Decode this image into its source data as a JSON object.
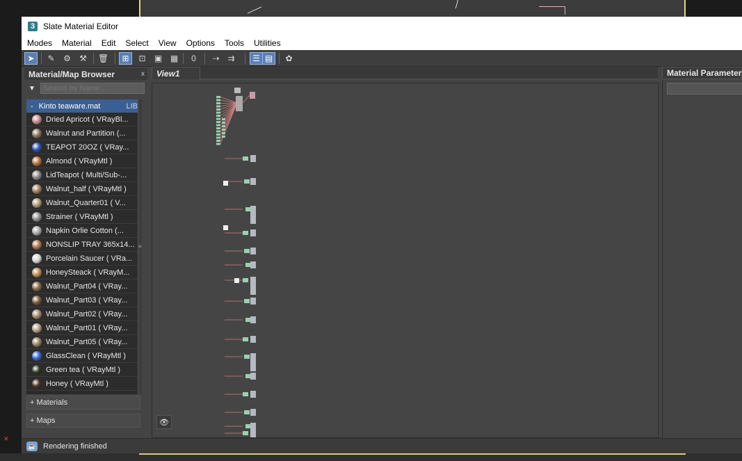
{
  "window": {
    "title": "Slate Material Editor",
    "app_icon": "3"
  },
  "menu": [
    "Modes",
    "Material",
    "Edit",
    "Select",
    "View",
    "Options",
    "Tools",
    "Utilities"
  ],
  "toolbar": {
    "icons": [
      {
        "name": "select-tool-icon",
        "glyph": "➤",
        "active": true
      },
      {
        "name": "pick-material-icon",
        "glyph": "✎",
        "active": false
      },
      {
        "name": "put-to-scene-icon",
        "glyph": "⚙",
        "active": false
      },
      {
        "name": "assign-material-icon",
        "glyph": "⚒",
        "active": false
      },
      {
        "name": "delete-icon",
        "glyph": "🗑",
        "active": false
      },
      {
        "name": "move-children-icon",
        "glyph": "⊞",
        "active": true
      },
      {
        "name": "lock-icon",
        "glyph": "⊡",
        "active": false
      },
      {
        "name": "show-map-icon",
        "glyph": "▣",
        "active": false
      },
      {
        "name": "show-background-icon",
        "glyph": "▦",
        "active": false
      },
      {
        "name": "material-id-icon",
        "glyph": "0",
        "active": false
      },
      {
        "name": "layout-all-icon",
        "glyph": "⇢",
        "active": false
      },
      {
        "name": "layout-children-icon",
        "glyph": "⇉",
        "active": false
      },
      {
        "name": "material-param-icon",
        "glyph": "☰",
        "active": true
      },
      {
        "name": "navigator-icon",
        "glyph": "▤",
        "active": true
      },
      {
        "name": "render-map-icon",
        "glyph": "✿",
        "active": false
      }
    ]
  },
  "browser": {
    "title": "Material/Map Browser",
    "close": "x",
    "search_placeholder": "Search by Name ...",
    "library": {
      "name": "Kinto teaware.mat",
      "tag": "LIB",
      "collapse": "-"
    },
    "materials": [
      {
        "label": "Dried Apricot  ( VRayBl...",
        "color": "#c98b8b"
      },
      {
        "label": "Walnut and Partition  (...",
        "color": "#8b7660"
      },
      {
        "label": "TEAPOT 20OZ  ( VRay...",
        "color": "#2f55b8"
      },
      {
        "label": "Almond  ( VRayMtl )",
        "color": "#b8743a"
      },
      {
        "label": "LidTeapot  ( Multi/Sub-...",
        "color": "#8a8a8a"
      },
      {
        "label": "Walnut_half  ( VRayMtl )",
        "color": "#a08060"
      },
      {
        "label": "Walnut_Quarter01  ( V...",
        "color": "#b49a7a"
      },
      {
        "label": "Strainer  ( VRayMtl )",
        "color": "#909090"
      },
      {
        "label": "Napkin Orlie Cotton  (...",
        "color": "#a8a8a8"
      },
      {
        "label": "NONSLIP TRAY 365x14...",
        "color": "#b07850"
      },
      {
        "label": "Porcelain Saucer  ( VRa...",
        "color": "#d6d6d6"
      },
      {
        "label": "HoneySteack  ( VRayM...",
        "color": "#c08e58"
      },
      {
        "label": "Walnut_Part04  ( VRay...",
        "color": "#8a6a4a"
      },
      {
        "label": "Walnut_Part03  ( VRay...",
        "color": "#7a5a3c"
      },
      {
        "label": "Walnut_Part02  ( VRay...",
        "color": "#a38a6c"
      },
      {
        "label": "Walnut_Part01  ( VRay...",
        "color": "#b6a08a"
      },
      {
        "label": "Walnut_Part05  ( VRay...",
        "color": "#9b8466"
      },
      {
        "label": "GlassClean  ( VRayMtl )",
        "color": "#3a6ad0"
      },
      {
        "label": "Green tea  ( VRayMtl )",
        "color": "#2e3a20"
      },
      {
        "label": "Honey  ( VRayMtl )",
        "color": "#4a3424"
      }
    ],
    "sections": [
      "+ Materials",
      "+ Maps"
    ]
  },
  "view": {
    "tab": "View1"
  },
  "params": {
    "title": "Material Parameter"
  },
  "status": {
    "text": "Rendering finished"
  }
}
